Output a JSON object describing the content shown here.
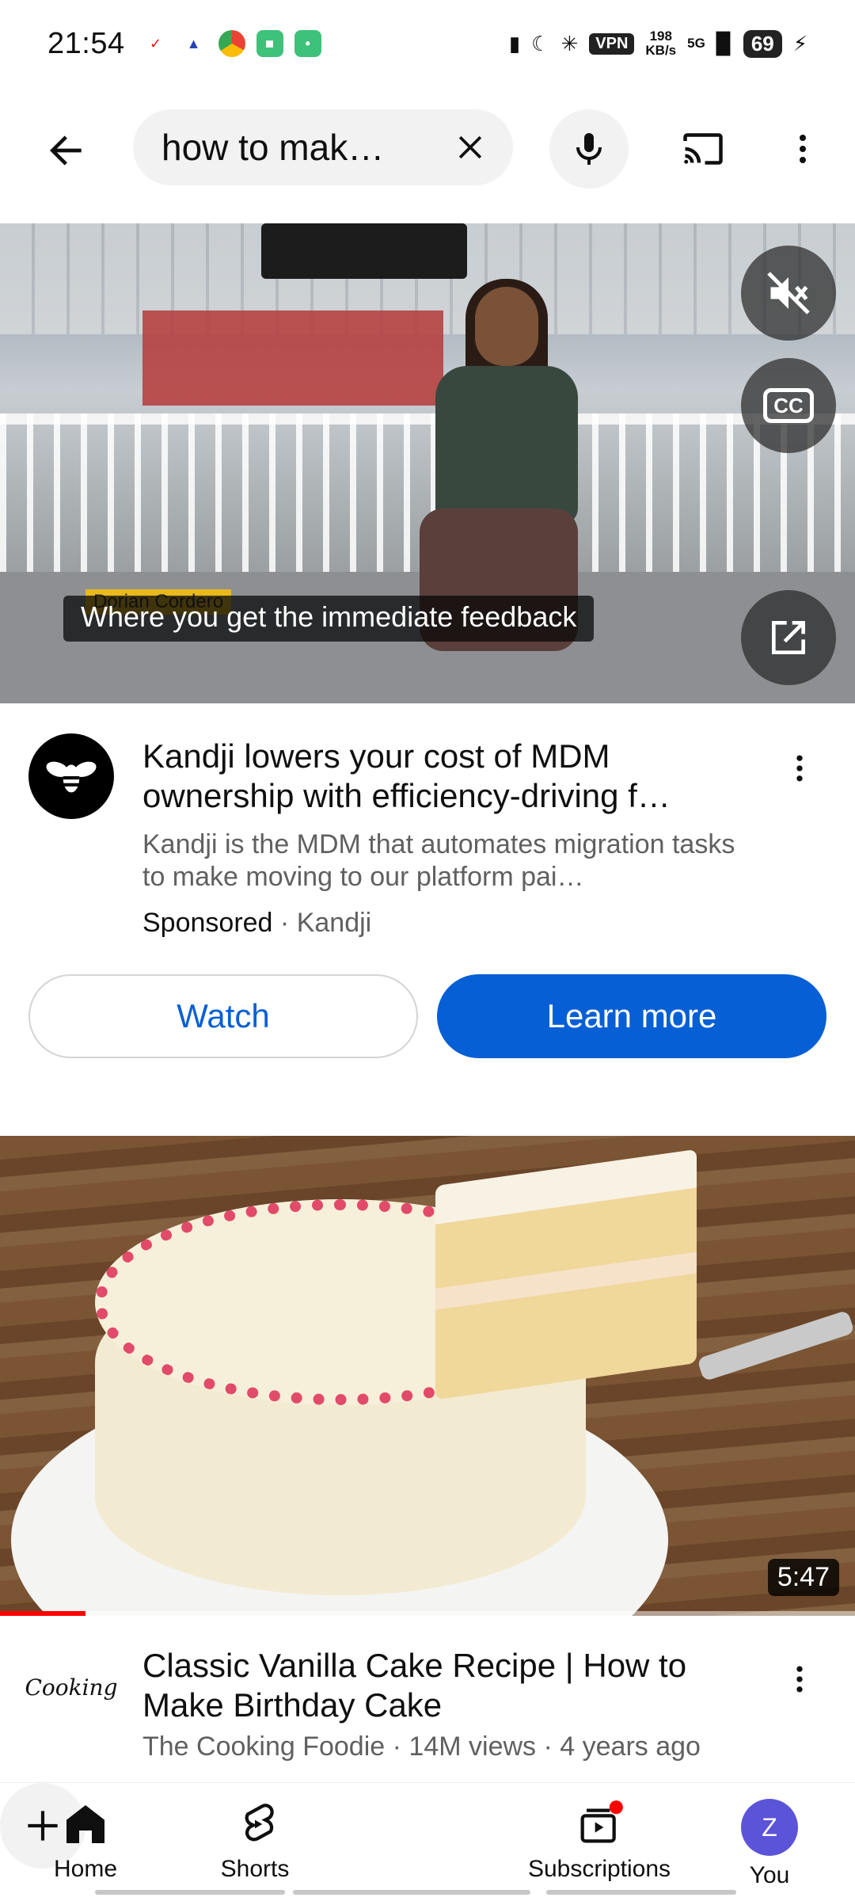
{
  "status_bar": {
    "time": "21:54",
    "vpn": "VPN",
    "speed_value": "198",
    "speed_unit": "KB/s",
    "network": "5G",
    "battery": "69"
  },
  "search": {
    "query": "how to mak…"
  },
  "ad": {
    "caption": "Where you get the immediate feedback",
    "name_tag": "Dorian Cordero",
    "title": "Kandji lowers your cost of MDM ownership with efficiency-driving f…",
    "description": "Kandji is the MDM that automates migration tasks to make moving to our platform pai…",
    "sponsored_label": "Sponsored",
    "separator": "·",
    "advertiser": "Kandji",
    "watch_label": "Watch",
    "learn_more_label": "Learn more"
  },
  "video": {
    "duration": "5:47",
    "progress_fraction": 0.1,
    "title": "Classic Vanilla Cake Recipe | How to Make Birthday Cake",
    "channel": "The Cooking Foodie",
    "views": "14M views",
    "age": "4 years ago",
    "separator": "·",
    "channel_logo_text": "Cooking"
  },
  "bottom_nav": {
    "home": "Home",
    "shorts": "Shorts",
    "subscriptions": "Subscriptions",
    "you": "You",
    "you_initial": "Z"
  },
  "colors": {
    "accent_blue": "#065fd4",
    "youtube_red": "#ff0000"
  }
}
